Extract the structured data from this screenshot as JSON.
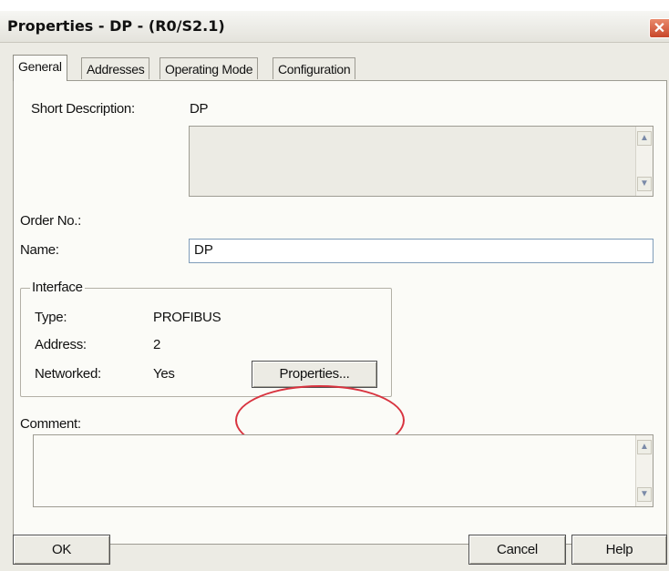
{
  "window": {
    "title": "Properties - DP - (R0/S2.1)",
    "close_glyph": "✕"
  },
  "tabs": [
    {
      "label": "General",
      "active": true
    },
    {
      "label": "Addresses",
      "active": false
    },
    {
      "label": "Operating Mode",
      "active": false
    },
    {
      "label": "Configuration",
      "active": false
    }
  ],
  "general": {
    "short_description_label": "Short Description:",
    "short_description_value": "DP",
    "order_no_label": "Order No.:",
    "name_label": "Name:",
    "name_value": "DP",
    "interface": {
      "legend": "Interface",
      "type_label": "Type:",
      "type_value": "PROFIBUS",
      "address_label": "Address:",
      "address_value": "2",
      "networked_label": "Networked:",
      "networked_value": "Yes",
      "properties_button": "Properties..."
    },
    "comment_label": "Comment:"
  },
  "footer": {
    "ok_label": "OK",
    "cancel_label": "Cancel",
    "help_label": "Help"
  },
  "colors": {
    "highlight_oval": "#d8333f",
    "dialog_bg": "#ecebe4",
    "panel_bg": "#fbfbf7"
  },
  "icons": {
    "scroll_up": "scroll-up-arrow-icon",
    "scroll_down": "scroll-down-arrow-icon"
  }
}
